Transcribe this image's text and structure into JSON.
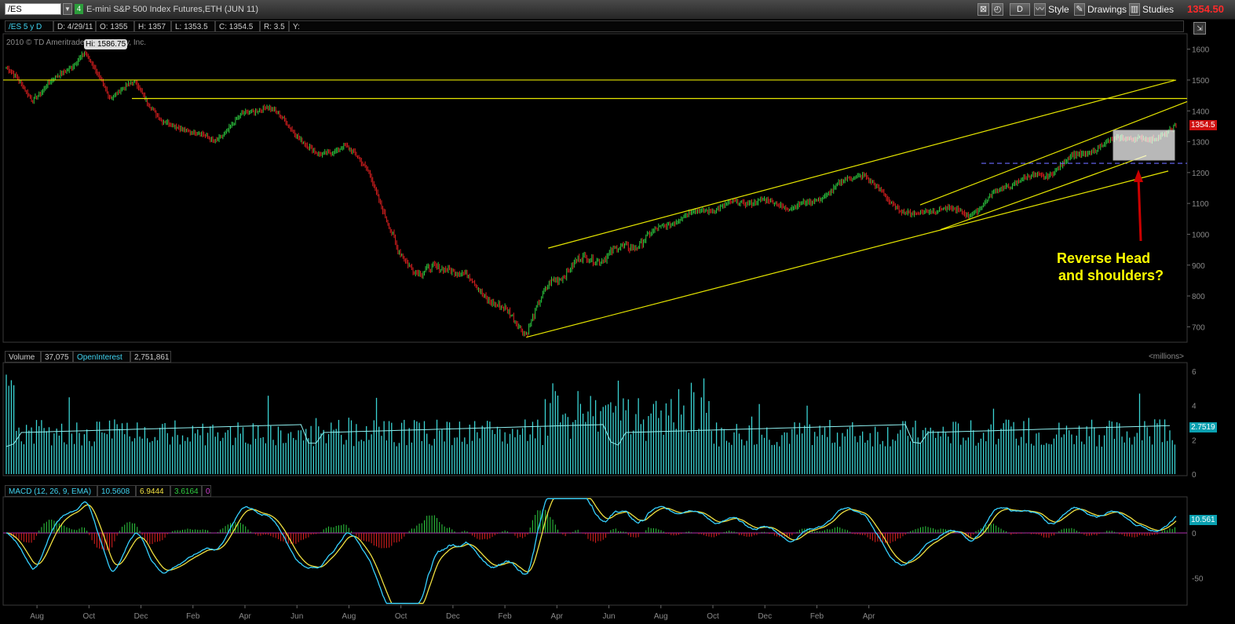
{
  "toolbar": {
    "symbol": "/ES",
    "link_number": "4",
    "description": "E-mini S&P 500 Index Futures,ETH (JUN 11)",
    "period_button": "D",
    "style_label": "Style",
    "drawings_label": "Drawings",
    "studies_label": "Studies",
    "last_price": "1354.50"
  },
  "price_header": {
    "symbol_period": "/ES 5 y D",
    "date": "D: 4/29/11",
    "open": "O: 1355",
    "high": "H: 1357",
    "low": "L: 1353.5",
    "close": "C: 1354.5",
    "range": "R: 3.5",
    "y": "Y:",
    "copyright": "2010 © TD Ameritrade IP Company, Inc."
  },
  "volume_header": {
    "label": "Volume",
    "value": "37,075",
    "oi_label": "OpenInterest",
    "oi_value": "2,751,861",
    "units": "<millions>"
  },
  "macd_header": {
    "label": "MACD (12, 26, 9, EMA)",
    "value": "10.5608",
    "avg": "6.9444",
    "diff": "3.6164",
    "zero": "0"
  },
  "annotation": {
    "line1": "Reverse Head",
    "line2": "and shoulders?"
  },
  "colors": {
    "up": "#2ecc40",
    "down": "#e02020",
    "trendline": "#e6e600",
    "volume": "#3ad3d3",
    "oi": "#8ff0f0",
    "macd": "#35d0ff",
    "macd_avg": "#f0e040",
    "axis_text": "#8a8a8a",
    "annotation": "#ffff00",
    "arrow": "#cc0000"
  },
  "chart_data": [
    {
      "type": "candlestick",
      "title": "/ES 5 y D",
      "yticks": [
        700,
        800,
        900,
        1000,
        1100,
        1200,
        1300,
        1400,
        1500,
        1600
      ],
      "ylim": [
        650,
        1650
      ],
      "xticks": [
        "Aug",
        "Oct",
        "Dec",
        "Feb",
        "Apr",
        "Jun",
        "Aug",
        "Oct",
        "Dec",
        "Feb",
        "Apr",
        "Jun",
        "Aug",
        "Oct",
        "Dec",
        "Feb",
        "Apr"
      ],
      "x_range": [
        "2007-08",
        "2011-04"
      ],
      "high_label": "Hi: 1586.75",
      "last_label": "1354.5",
      "series": [
        {
          "name": "close",
          "x": [
            "2007-07",
            "2007-08",
            "2007-09",
            "2007-10",
            "2007-11",
            "2007-12",
            "2008-01",
            "2008-02",
            "2008-03",
            "2008-04",
            "2008-05",
            "2008-06",
            "2008-07",
            "2008-08",
            "2008-09",
            "2008-10",
            "2008-11",
            "2008-12",
            "2009-01",
            "2009-02",
            "2009-03",
            "2009-04",
            "2009-05",
            "2009-06",
            "2009-07",
            "2009-08",
            "2009-09",
            "2009-10",
            "2009-11",
            "2009-12",
            "2010-01",
            "2010-02",
            "2010-03",
            "2010-04",
            "2010-05",
            "2010-06",
            "2010-07",
            "2010-08",
            "2010-09",
            "2010-10",
            "2010-11",
            "2010-12",
            "2011-01",
            "2011-02",
            "2011-03",
            "2011-04"
          ],
          "values": [
            1540,
            1440,
            1510,
            1586,
            1450,
            1490,
            1360,
            1340,
            1300,
            1380,
            1420,
            1340,
            1250,
            1290,
            1200,
            950,
            870,
            900,
            840,
            760,
            690,
            850,
            910,
            930,
            960,
            1010,
            1060,
            1080,
            1100,
            1110,
            1090,
            1100,
            1160,
            1200,
            1100,
            1060,
            1090,
            1060,
            1130,
            1180,
            1190,
            1250,
            1280,
            1320,
            1300,
            1354.5
          ]
        }
      ],
      "trendlines": [
        {
          "name": "resistance-horizontal-1500",
          "y": [
            1500,
            1500
          ]
        },
        {
          "name": "resistance-horizontal-1440",
          "y": [
            1440,
            1440
          ]
        },
        {
          "name": "upper-channel",
          "from": [
            "2009-03",
            955
          ],
          "to": [
            "2011-04",
            1500
          ]
        },
        {
          "name": "lower-channel",
          "from": [
            "2009-03",
            666
          ],
          "to": [
            "2011-04",
            1205
          ]
        },
        {
          "name": "neckline",
          "y": [
            1230,
            1230
          ]
        }
      ]
    },
    {
      "type": "bar",
      "title": "Volume",
      "ylabel": "<millions>",
      "yticks": [
        0,
        2,
        4,
        6
      ],
      "ylim": [
        0,
        6.5
      ],
      "last_label": "2.7519",
      "series": [
        {
          "name": "Volume",
          "note": "daily volume bars, mostly 1.5–3.5M, spikes to ~6M in Oct 2008"
        },
        {
          "name": "OpenInterest",
          "values_level": 2.7519
        }
      ]
    },
    {
      "type": "line",
      "title": "MACD (12, 26, 9, EMA)",
      "yticks": [
        -50,
        0
      ],
      "ylim": [
        -80,
        40
      ],
      "last_label": "10.561",
      "series": [
        {
          "name": "Value",
          "last": 10.5608
        },
        {
          "name": "Avg",
          "last": 6.9444
        },
        {
          "name": "Diff",
          "last": 3.6164
        }
      ]
    }
  ]
}
